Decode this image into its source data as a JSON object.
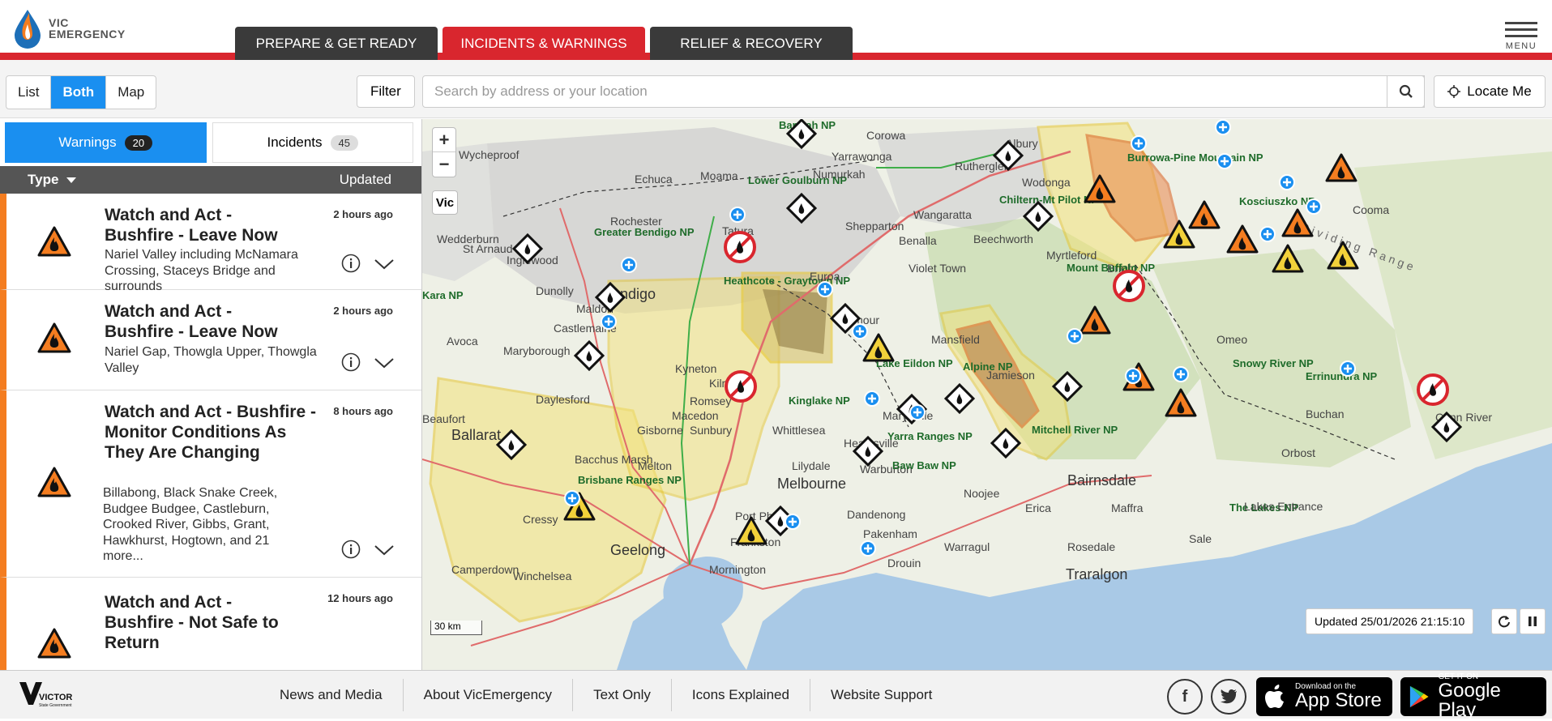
{
  "header": {
    "logo_line1": "VIC",
    "logo_line2": "EMERGENCY",
    "tabs": [
      {
        "label": "PREPARE & GET READY",
        "active": false
      },
      {
        "label": "INCIDENTS & WARNINGS",
        "active": true
      },
      {
        "label": "RELIEF & RECOVERY",
        "active": false
      }
    ],
    "menu_label": "MENU",
    "accent_color": "#d9262e"
  },
  "toolbar": {
    "views": [
      "List",
      "Both",
      "Map"
    ],
    "active_view": "Both",
    "filter_label": "Filter",
    "search_placeholder": "Search by address or your location",
    "locate_label": "Locate Me"
  },
  "panel": {
    "tabs": [
      {
        "label": "Warnings",
        "count": "20",
        "active": true
      },
      {
        "label": "Incidents",
        "count": "45",
        "active": false
      }
    ],
    "header_type": "Type",
    "header_updated": "Updated",
    "items": [
      {
        "title": "Watch and Act - Bushfire - Leave Now",
        "location": "Nariel Valley including McNamara Crossing, Staceys Bridge and surrounds",
        "age": "2 hours ago"
      },
      {
        "title": "Watch and Act - Bushfire - Leave Now",
        "location": "Nariel Gap, Thowgla Upper, Thowgla Valley",
        "age": "2 hours ago"
      },
      {
        "title": "Watch and Act - Bushfire - Monitor Conditions As They Are Changing",
        "location": "Billabong, Black Snake Creek, Budgee Budgee, Castleburn, Crooked River, Gibbs, Grant, Hawkhurst, Hogtown, and 21 more...",
        "age": "8 hours ago"
      },
      {
        "title": "Watch and Act - Bushfire - Not Safe to Return",
        "location": "",
        "age": "12 hours ago"
      }
    ]
  },
  "map": {
    "zoom_in": "+",
    "zoom_out": "−",
    "vic_label": "Vic",
    "scale": "30 km",
    "updated": "Updated 25/01/2026 21:15:10",
    "labels": [
      {
        "t": "Barmah NP"
      },
      {
        "t": "Corowa"
      },
      {
        "t": "Albury"
      },
      {
        "t": "Wycheproof"
      },
      {
        "t": "Echuca"
      },
      {
        "t": "Moama"
      },
      {
        "t": "Yarrawonga"
      },
      {
        "t": "Rutherglen"
      },
      {
        "t": "Wodonga"
      },
      {
        "t": "Lower Goulburn NP"
      },
      {
        "t": "Numurkah"
      },
      {
        "t": "Chiltern-Mt Pilot NP"
      },
      {
        "t": "Burrowa-Pine Mountain NP"
      },
      {
        "t": "Kosciuszko NP"
      },
      {
        "t": "Cooma"
      },
      {
        "t": "Rochester"
      },
      {
        "t": "Shepparton"
      },
      {
        "t": "Wangaratta"
      },
      {
        "t": "Beechworth"
      },
      {
        "t": "Wedderburn"
      },
      {
        "t": "Greater Bendigo NP"
      },
      {
        "t": "Tatura"
      },
      {
        "t": "Benalla"
      },
      {
        "t": "St Arnaud"
      },
      {
        "t": "Inglewood"
      },
      {
        "t": "Bendigo"
      },
      {
        "t": "Myrtleford"
      },
      {
        "t": "Bright"
      },
      {
        "t": "Mount Buffalo NP"
      },
      {
        "t": "Violet Town"
      },
      {
        "t": "Heathcote - Graytown NP"
      },
      {
        "t": "Euroa"
      },
      {
        "t": "Dunolly"
      },
      {
        "t": "Kara NP"
      },
      {
        "t": "Maldon"
      },
      {
        "t": "Castlemaine"
      },
      {
        "t": "Seymour"
      },
      {
        "t": "Mansfield"
      },
      {
        "t": "Omeo"
      },
      {
        "t": "Avoca"
      },
      {
        "t": "Maryborough"
      },
      {
        "t": "Kyneton"
      },
      {
        "t": "Kilmore"
      },
      {
        "t": "Alpine NP"
      },
      {
        "t": "Jamieson"
      },
      {
        "t": "Lake Eildon NP"
      },
      {
        "t": "Snowy River NP"
      },
      {
        "t": "Errinundra NP"
      },
      {
        "t": "Daylesford"
      },
      {
        "t": "Romsey"
      },
      {
        "t": "Macedon"
      },
      {
        "t": "Kinglake NP"
      },
      {
        "t": "Marysville"
      },
      {
        "t": "Buchan"
      },
      {
        "t": "Cann River"
      },
      {
        "t": "Beaufort"
      },
      {
        "t": "Ballarat"
      },
      {
        "t": "Gisborne"
      },
      {
        "t": "Sunbury"
      },
      {
        "t": "Whittlesea"
      },
      {
        "t": "Healesville"
      },
      {
        "t": "Yarra Ranges NP"
      },
      {
        "t": "Mitchell River NP"
      },
      {
        "t": "Orbost"
      },
      {
        "t": "Bacchus Marsh"
      },
      {
        "t": "Melton"
      },
      {
        "t": "Lilydale"
      },
      {
        "t": "Warburton"
      },
      {
        "t": "Baw Baw NP"
      },
      {
        "t": "Brisbane Ranges NP"
      },
      {
        "t": "Melbourne"
      },
      {
        "t": "Bairnsdale"
      },
      {
        "t": "Noojee"
      },
      {
        "t": "Dandenong"
      },
      {
        "t": "Erica"
      },
      {
        "t": "Maffra"
      },
      {
        "t": "The Lakes NP"
      },
      {
        "t": "Lakes Entrance"
      },
      {
        "t": "Cressy"
      },
      {
        "t": "Port Phillip"
      },
      {
        "t": "Pakenham"
      },
      {
        "t": "Sale"
      },
      {
        "t": "Geelong"
      },
      {
        "t": "Frankston"
      },
      {
        "t": "Warragul"
      },
      {
        "t": "Rosedale"
      },
      {
        "t": "Camperdown"
      },
      {
        "t": "Winchelsea"
      },
      {
        "t": "Mornington"
      },
      {
        "t": "Drouin"
      },
      {
        "t": "Traralgon"
      },
      {
        "t": "Dividing Range"
      }
    ]
  },
  "footer": {
    "links": [
      "News and Media",
      "About VicEmergency",
      "Text Only",
      "Icons Explained",
      "Website Support"
    ],
    "appstore_small": "Download on the",
    "appstore_big": "App Store",
    "play_small": "GET IT ON",
    "play_big": "Google Play",
    "vic_logo": "VICTORIA",
    "vic_logo_sub": "State Government"
  }
}
